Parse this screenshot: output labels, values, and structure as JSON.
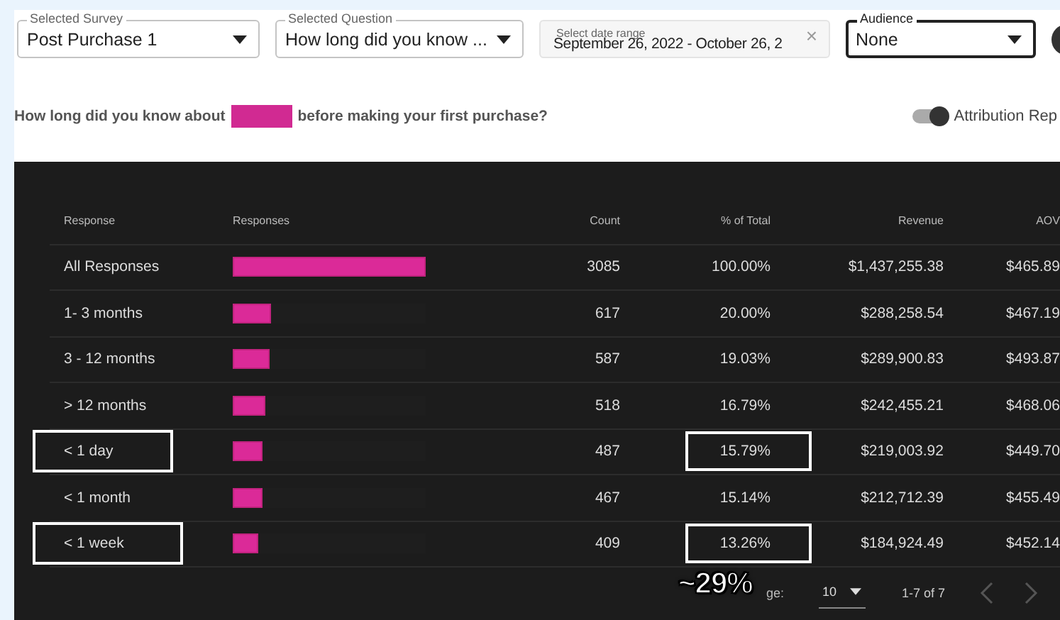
{
  "filters": [
    {
      "kind": "select",
      "label": "Selected Survey",
      "value": "Post Purchase 1",
      "focused": false
    },
    {
      "kind": "select",
      "label": "Selected Question",
      "value": "How long did you know ...",
      "focused": false
    },
    {
      "kind": "date",
      "label": "Select date range",
      "value": "September 26, 2022 - October 26, 2",
      "clear": "×",
      "focused": false
    },
    {
      "kind": "select",
      "label": "Audience",
      "value": "None",
      "focused": true
    }
  ],
  "question": {
    "before": "How long did you know about",
    "redacted": true,
    "after": "before making your first purchase?"
  },
  "toggle": {
    "label": "Attribution Rep",
    "on": true
  },
  "table": {
    "columns": [
      "Response",
      "Responses",
      "Count",
      "% of Total",
      "Revenue",
      "AOV"
    ],
    "rows": [
      {
        "response": "All Responses",
        "level": 1,
        "count": "3085",
        "percent": "100.00%",
        "revenue": "$1,437,255.38",
        "aov": "$465.89",
        "highlight_response": false,
        "highlight_percent": false
      },
      {
        "response": "1- 3 months",
        "level": 0.2,
        "count": "617",
        "percent": "20.00%",
        "revenue": "$288,258.54",
        "aov": "$467.19",
        "highlight_response": false,
        "highlight_percent": false
      },
      {
        "response": "3 - 12 months",
        "level": 0.19,
        "count": "587",
        "percent": "19.03%",
        "revenue": "$289,900.83",
        "aov": "$493.87",
        "highlight_response": false,
        "highlight_percent": false
      },
      {
        "response": "> 12 months",
        "level": 0.168,
        "count": "518",
        "percent": "16.79%",
        "revenue": "$242,455.21",
        "aov": "$468.06",
        "highlight_response": false,
        "highlight_percent": false
      },
      {
        "response": "< 1 day",
        "level": 0.158,
        "count": "487",
        "percent": "15.79%",
        "revenue": "$219,003.92",
        "aov": "$449.70",
        "highlight_response": true,
        "highlight_percent": true
      },
      {
        "response": "< 1 month",
        "level": 0.151,
        "count": "467",
        "percent": "15.14%",
        "revenue": "$212,712.39",
        "aov": "$455.49",
        "highlight_response": false,
        "highlight_percent": false
      },
      {
        "response": "< 1 week",
        "level": 0.133,
        "count": "409",
        "percent": "13.26%",
        "revenue": "$184,924.49",
        "aov": "$452.14",
        "highlight_response": true,
        "highlight_percent": true
      }
    ]
  },
  "pagination": {
    "rows_per_page_label": "ge:",
    "rows_per_page": "10",
    "range": "1-7 of 7",
    "prev_disabled": true,
    "next_disabled": true
  },
  "annotation": "~29%"
}
